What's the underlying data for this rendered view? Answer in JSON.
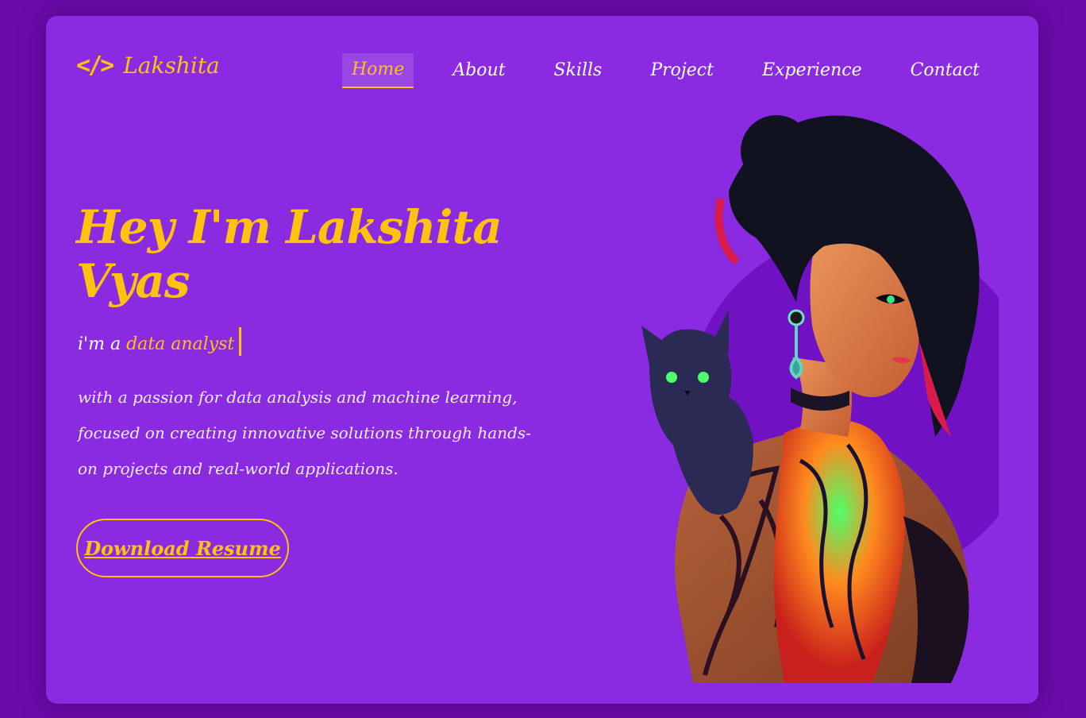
{
  "logo": {
    "icon": "code-icon",
    "icon_glyph": "</>",
    "text": "Lakshita"
  },
  "nav": {
    "items": [
      {
        "label": "Home",
        "active": true
      },
      {
        "label": "About",
        "active": false
      },
      {
        "label": "Skills",
        "active": false
      },
      {
        "label": "Project",
        "active": false
      },
      {
        "label": "Experience",
        "active": false
      },
      {
        "label": "Contact",
        "active": false
      }
    ]
  },
  "hero": {
    "title": "Hey I'm Lakshita Vyas",
    "role_prefix": "i'm a",
    "role_highlight": "data analyst",
    "description": "with a passion for data analysis and machine learning, focused on creating innovative solutions through hands-on projects and real-world applications.",
    "button_label": "Download Resume",
    "illustration": "woman-with-cat-illustration"
  },
  "colors": {
    "background": "#6a0ba8",
    "card": "#8a2be2",
    "accent": "#ffc20e",
    "circle": "#7012c4"
  }
}
